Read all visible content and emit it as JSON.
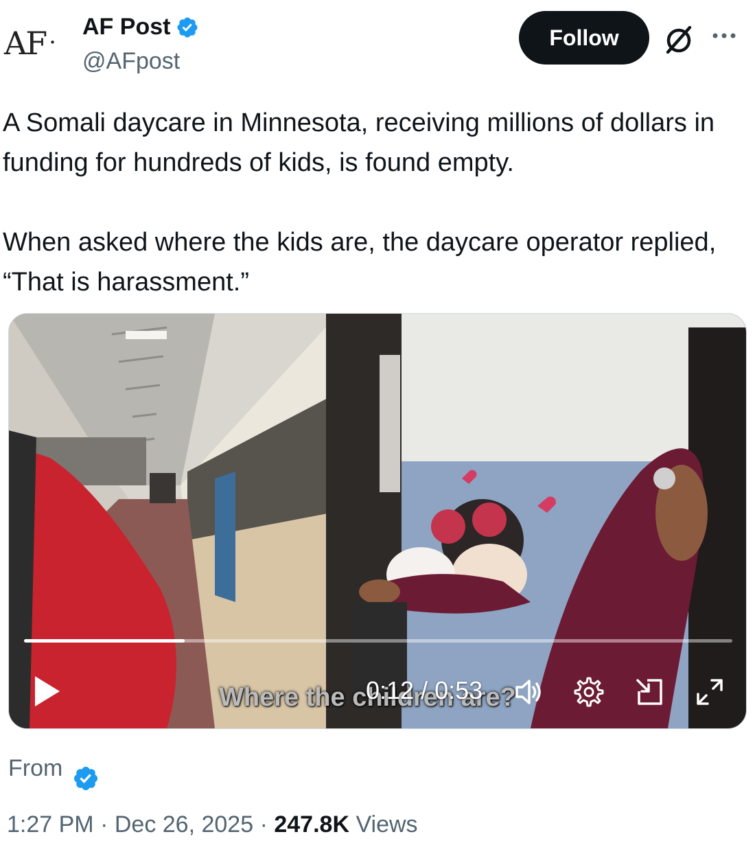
{
  "author": {
    "avatar_text": "AF",
    "avatar_dot": ".",
    "display_name": "AF Post",
    "handle": "@AFpost",
    "verified": true
  },
  "actions": {
    "follow_label": "Follow"
  },
  "tweet": {
    "paragraphs": [
      "A Somali daycare in Minnesota, receiving millions of dollars in funding for hundreds of kids, is found empty.",
      "When asked where the kids are, the daycare operator replied, “That is harassment.”"
    ]
  },
  "video": {
    "caption": "Where the children are?",
    "current_time": "0:12",
    "duration": "0:53",
    "time_display": "0:12 / 0:53",
    "progress_fraction": 0.2264
  },
  "source": {
    "label": "From"
  },
  "meta": {
    "time": "1:27 PM",
    "separator": "·",
    "date": "Dec 26, 2025",
    "views_count": "247.8K",
    "views_label": "Views"
  },
  "colors": {
    "verified": "#1d9bf0",
    "text_primary": "#0f1419",
    "text_secondary": "#536471",
    "follow_bg": "#0f1419"
  }
}
